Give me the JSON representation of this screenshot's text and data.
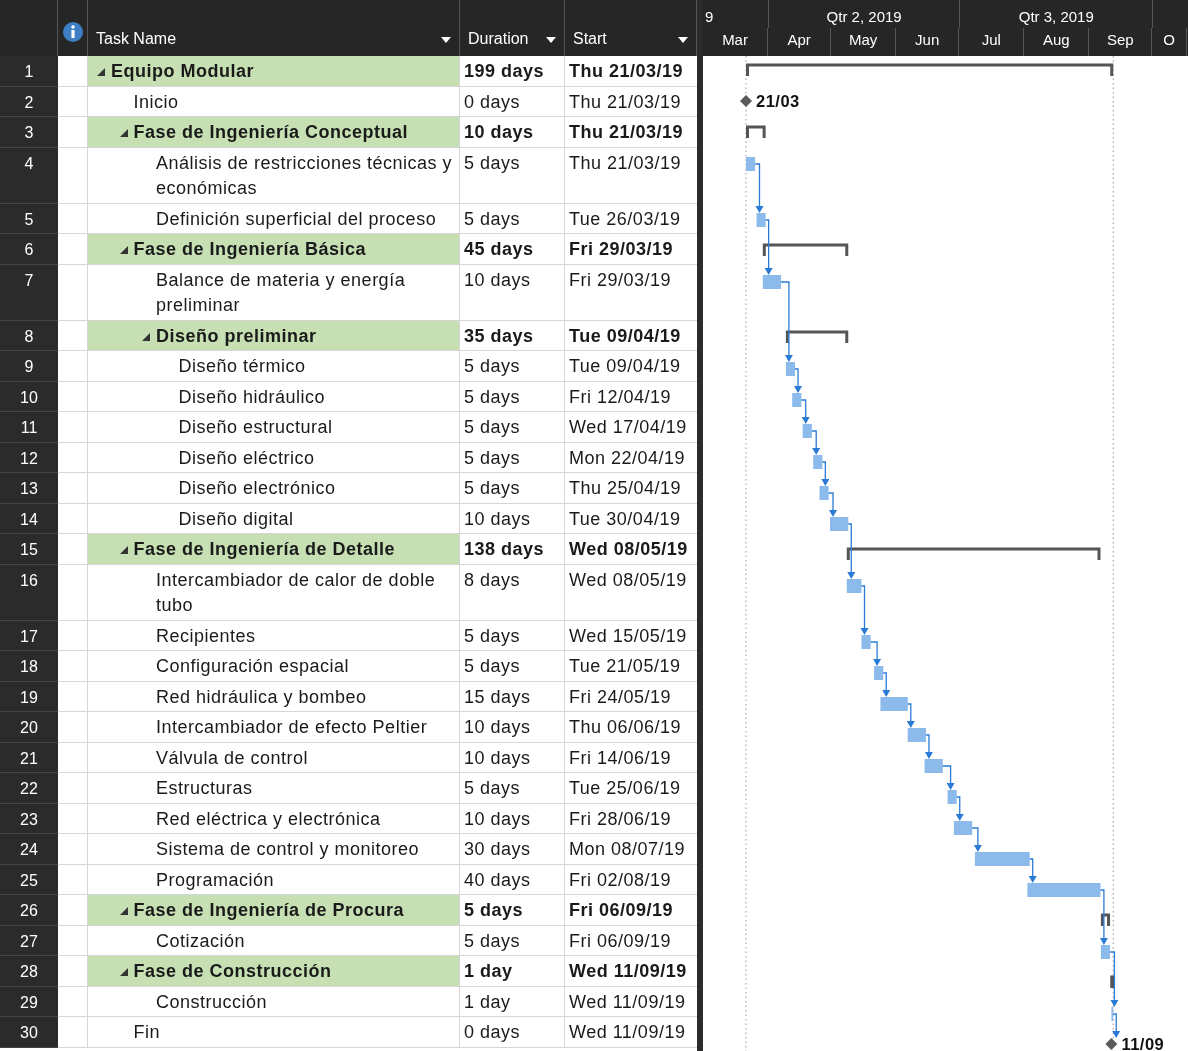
{
  "columns": [
    {
      "label": "Task Name"
    },
    {
      "label": "Duration"
    },
    {
      "label": "Start"
    }
  ],
  "timescale": {
    "quarters": [
      "9",
      "Qtr 2, 2019",
      "Qtr 3, 2019"
    ],
    "months": [
      "Mar",
      "Apr",
      "May",
      "Jun",
      "Jul",
      "Aug",
      "Sep",
      "O"
    ]
  },
  "tasks": [
    {
      "id": "1",
      "name": "Equipo Modular",
      "duration": "199 days",
      "start": "Thu 21/03/19",
      "kind": "summary",
      "expanded": true,
      "children": [
        {
          "id": "2",
          "name": "Inicio",
          "duration": "0 days",
          "start": "Thu 21/03/19",
          "kind": "milestone",
          "bar_label": "21/03"
        },
        {
          "id": "3",
          "name": "Fase  de Ingeniería Conceptual",
          "duration": "10 days",
          "start": "Thu 21/03/19",
          "kind": "summary",
          "expanded": true,
          "children": [
            {
              "id": "4",
              "name": "Análisis de restricciones técnicas y económicas",
              "duration": "5 days",
              "start": "Thu 21/03/19",
              "kind": "task"
            },
            {
              "id": "5",
              "name": "Definición superficial del proceso",
              "duration": "5 days",
              "start": "Tue 26/03/19",
              "kind": "task"
            }
          ]
        },
        {
          "id": "6",
          "name": "Fase de Ingeniería Básica",
          "duration": "45 days",
          "start": "Fri 29/03/19",
          "kind": "summary",
          "expanded": true,
          "children": [
            {
              "id": "7",
              "name": "Balance de materia y energía preliminar",
              "duration": "10 days",
              "start": "Fri 29/03/19",
              "kind": "task"
            },
            {
              "id": "8",
              "name": "Diseño preliminar",
              "duration": "35 days",
              "start": "Tue 09/04/19",
              "kind": "summary",
              "expanded": true,
              "children": [
                {
                  "id": "9",
                  "name": "Diseño térmico",
                  "duration": "5 days",
                  "start": "Tue 09/04/19",
                  "kind": "task"
                },
                {
                  "id": "10",
                  "name": "Diseño hidráulico",
                  "duration": "5 days",
                  "start": "Fri 12/04/19",
                  "kind": "task"
                },
                {
                  "id": "11",
                  "name": "Diseño estructural",
                  "duration": "5 days",
                  "start": "Wed 17/04/19",
                  "kind": "task"
                },
                {
                  "id": "12",
                  "name": "Diseño eléctrico",
                  "duration": "5 days",
                  "start": "Mon 22/04/19",
                  "kind": "task"
                },
                {
                  "id": "13",
                  "name": "Diseño electrónico",
                  "duration": "5 days",
                  "start": "Thu 25/04/19",
                  "kind": "task"
                },
                {
                  "id": "14",
                  "name": "Diseño digital",
                  "duration": "10 days",
                  "start": "Tue 30/04/19",
                  "kind": "task"
                }
              ]
            }
          ]
        },
        {
          "id": "15",
          "name": "Fase de Ingeniería de Detalle",
          "duration": "138 days",
          "start": "Wed 08/05/19",
          "kind": "summary",
          "expanded": true,
          "children": [
            {
              "id": "16",
              "name": "Intercambiador de calor de doble tubo",
              "duration": "8 days",
              "start": "Wed 08/05/19",
              "kind": "task"
            },
            {
              "id": "17",
              "name": "Recipientes",
              "duration": "5 days",
              "start": "Wed 15/05/19",
              "kind": "task"
            },
            {
              "id": "18",
              "name": "Configuración espacial",
              "duration": "5 days",
              "start": "Tue 21/05/19",
              "kind": "task"
            },
            {
              "id": "19",
              "name": "Red hidráulica y bombeo",
              "duration": "15 days",
              "start": "Fri 24/05/19",
              "kind": "task"
            },
            {
              "id": "20",
              "name": "Intercambiador de efecto Peltier",
              "duration": "10 days",
              "start": "Thu 06/06/19",
              "kind": "task"
            },
            {
              "id": "21",
              "name": "Válvula de control",
              "duration": "10 days",
              "start": "Fri 14/06/19",
              "kind": "task"
            },
            {
              "id": "22",
              "name": "Estructuras",
              "duration": "5 days",
              "start": "Tue 25/06/19",
              "kind": "task"
            },
            {
              "id": "23",
              "name": "Red eléctrica y electrónica",
              "duration": "10 days",
              "start": "Fri 28/06/19",
              "kind": "task"
            },
            {
              "id": "24",
              "name": "Sistema de control y monitoreo",
              "duration": "30 days",
              "start": "Mon 08/07/19",
              "kind": "task"
            },
            {
              "id": "25",
              "name": "Programación",
              "duration": "40 days",
              "start": "Fri 02/08/19",
              "kind": "task"
            }
          ]
        },
        {
          "id": "26",
          "name": "Fase de Ingeniería de Procura",
          "duration": "5 days",
          "start": "Fri 06/09/19",
          "kind": "summary",
          "expanded": true,
          "children": [
            {
              "id": "27",
              "name": "Cotización",
              "duration": "5 days",
              "start": "Fri 06/09/19",
              "kind": "task"
            }
          ]
        },
        {
          "id": "28",
          "name": "Fase de Construcción",
          "duration": "1 day",
          "start": "Wed 11/09/19",
          "kind": "summary",
          "expanded": true,
          "children": [
            {
              "id": "29",
              "name": "Construcción",
              "duration": "1 day",
              "start": "Wed 11/09/19",
              "kind": "task"
            }
          ]
        },
        {
          "id": "30",
          "name": "Fin",
          "duration": "0 days",
          "start": "Wed 11/09/19",
          "kind": "milestone",
          "bar_label": "11/09"
        }
      ]
    }
  ]
}
